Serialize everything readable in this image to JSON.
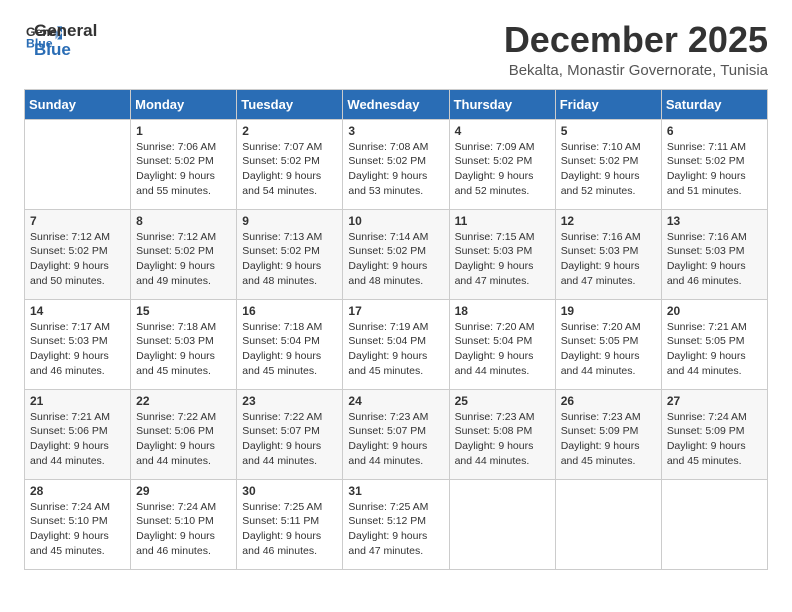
{
  "header": {
    "logo_general": "General",
    "logo_blue": "Blue",
    "month": "December 2025",
    "location": "Bekalta, Monastir Governorate, Tunisia"
  },
  "days_of_week": [
    "Sunday",
    "Monday",
    "Tuesday",
    "Wednesday",
    "Thursday",
    "Friday",
    "Saturday"
  ],
  "weeks": [
    [
      {
        "day": "",
        "info": ""
      },
      {
        "day": "1",
        "info": "Sunrise: 7:06 AM\nSunset: 5:02 PM\nDaylight: 9 hours\nand 55 minutes."
      },
      {
        "day": "2",
        "info": "Sunrise: 7:07 AM\nSunset: 5:02 PM\nDaylight: 9 hours\nand 54 minutes."
      },
      {
        "day": "3",
        "info": "Sunrise: 7:08 AM\nSunset: 5:02 PM\nDaylight: 9 hours\nand 53 minutes."
      },
      {
        "day": "4",
        "info": "Sunrise: 7:09 AM\nSunset: 5:02 PM\nDaylight: 9 hours\nand 52 minutes."
      },
      {
        "day": "5",
        "info": "Sunrise: 7:10 AM\nSunset: 5:02 PM\nDaylight: 9 hours\nand 52 minutes."
      },
      {
        "day": "6",
        "info": "Sunrise: 7:11 AM\nSunset: 5:02 PM\nDaylight: 9 hours\nand 51 minutes."
      }
    ],
    [
      {
        "day": "7",
        "info": "Sunrise: 7:12 AM\nSunset: 5:02 PM\nDaylight: 9 hours\nand 50 minutes."
      },
      {
        "day": "8",
        "info": "Sunrise: 7:12 AM\nSunset: 5:02 PM\nDaylight: 9 hours\nand 49 minutes."
      },
      {
        "day": "9",
        "info": "Sunrise: 7:13 AM\nSunset: 5:02 PM\nDaylight: 9 hours\nand 48 minutes."
      },
      {
        "day": "10",
        "info": "Sunrise: 7:14 AM\nSunset: 5:02 PM\nDaylight: 9 hours\nand 48 minutes."
      },
      {
        "day": "11",
        "info": "Sunrise: 7:15 AM\nSunset: 5:03 PM\nDaylight: 9 hours\nand 47 minutes."
      },
      {
        "day": "12",
        "info": "Sunrise: 7:16 AM\nSunset: 5:03 PM\nDaylight: 9 hours\nand 47 minutes."
      },
      {
        "day": "13",
        "info": "Sunrise: 7:16 AM\nSunset: 5:03 PM\nDaylight: 9 hours\nand 46 minutes."
      }
    ],
    [
      {
        "day": "14",
        "info": "Sunrise: 7:17 AM\nSunset: 5:03 PM\nDaylight: 9 hours\nand 46 minutes."
      },
      {
        "day": "15",
        "info": "Sunrise: 7:18 AM\nSunset: 5:03 PM\nDaylight: 9 hours\nand 45 minutes."
      },
      {
        "day": "16",
        "info": "Sunrise: 7:18 AM\nSunset: 5:04 PM\nDaylight: 9 hours\nand 45 minutes."
      },
      {
        "day": "17",
        "info": "Sunrise: 7:19 AM\nSunset: 5:04 PM\nDaylight: 9 hours\nand 45 minutes."
      },
      {
        "day": "18",
        "info": "Sunrise: 7:20 AM\nSunset: 5:04 PM\nDaylight: 9 hours\nand 44 minutes."
      },
      {
        "day": "19",
        "info": "Sunrise: 7:20 AM\nSunset: 5:05 PM\nDaylight: 9 hours\nand 44 minutes."
      },
      {
        "day": "20",
        "info": "Sunrise: 7:21 AM\nSunset: 5:05 PM\nDaylight: 9 hours\nand 44 minutes."
      }
    ],
    [
      {
        "day": "21",
        "info": "Sunrise: 7:21 AM\nSunset: 5:06 PM\nDaylight: 9 hours\nand 44 minutes."
      },
      {
        "day": "22",
        "info": "Sunrise: 7:22 AM\nSunset: 5:06 PM\nDaylight: 9 hours\nand 44 minutes."
      },
      {
        "day": "23",
        "info": "Sunrise: 7:22 AM\nSunset: 5:07 PM\nDaylight: 9 hours\nand 44 minutes."
      },
      {
        "day": "24",
        "info": "Sunrise: 7:23 AM\nSunset: 5:07 PM\nDaylight: 9 hours\nand 44 minutes."
      },
      {
        "day": "25",
        "info": "Sunrise: 7:23 AM\nSunset: 5:08 PM\nDaylight: 9 hours\nand 44 minutes."
      },
      {
        "day": "26",
        "info": "Sunrise: 7:23 AM\nSunset: 5:09 PM\nDaylight: 9 hours\nand 45 minutes."
      },
      {
        "day": "27",
        "info": "Sunrise: 7:24 AM\nSunset: 5:09 PM\nDaylight: 9 hours\nand 45 minutes."
      }
    ],
    [
      {
        "day": "28",
        "info": "Sunrise: 7:24 AM\nSunset: 5:10 PM\nDaylight: 9 hours\nand 45 minutes."
      },
      {
        "day": "29",
        "info": "Sunrise: 7:24 AM\nSunset: 5:10 PM\nDaylight: 9 hours\nand 46 minutes."
      },
      {
        "day": "30",
        "info": "Sunrise: 7:25 AM\nSunset: 5:11 PM\nDaylight: 9 hours\nand 46 minutes."
      },
      {
        "day": "31",
        "info": "Sunrise: 7:25 AM\nSunset: 5:12 PM\nDaylight: 9 hours\nand 47 minutes."
      },
      {
        "day": "",
        "info": ""
      },
      {
        "day": "",
        "info": ""
      },
      {
        "day": "",
        "info": ""
      }
    ]
  ]
}
